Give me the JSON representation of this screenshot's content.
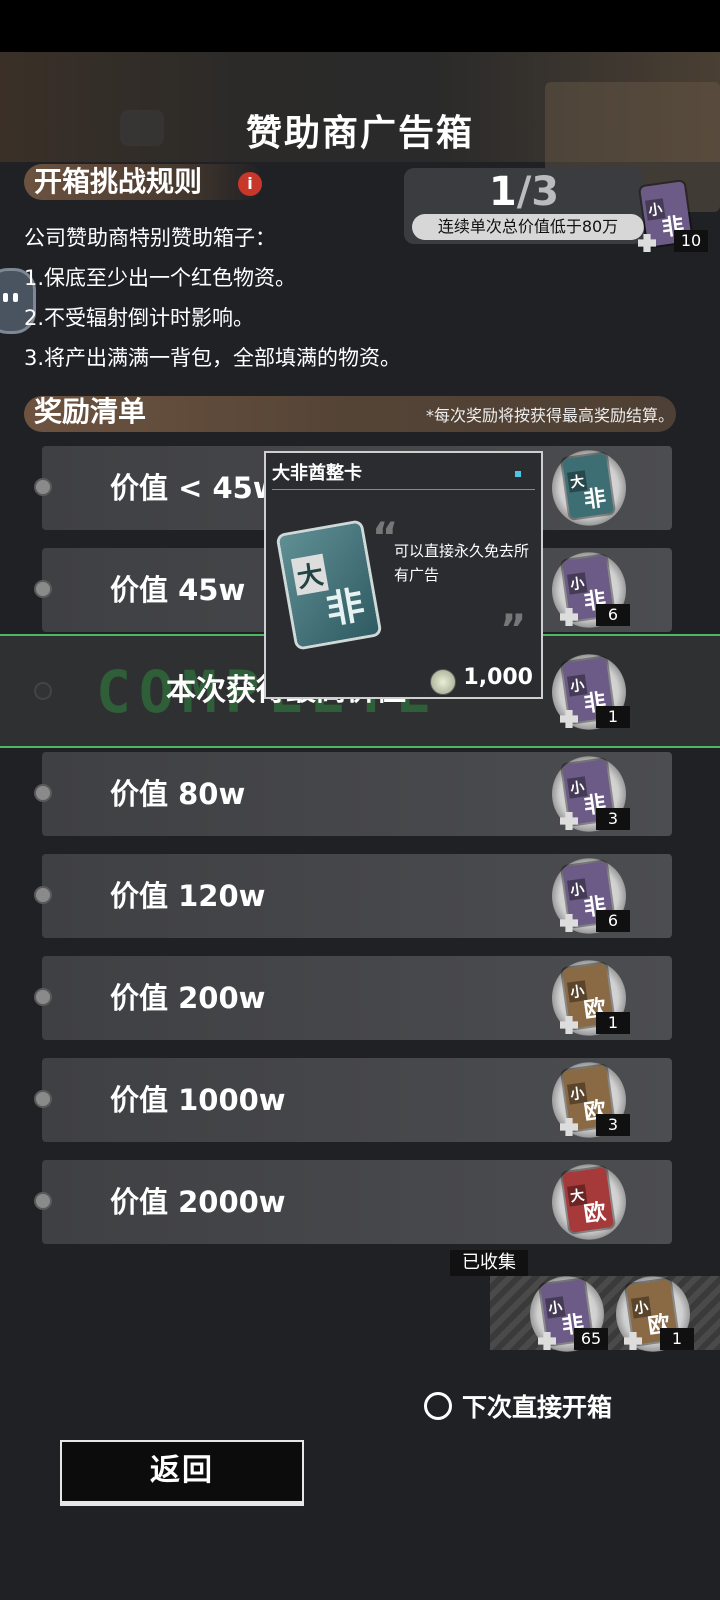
{
  "header": {
    "title": "赞助商广告箱"
  },
  "rules": {
    "title": "开箱挑战规则",
    "info_icon": "info-icon",
    "lines": [
      "公司赞助商特别赞助箱子：",
      "1.保底至少出一个红色物资。",
      "2.不受辐射倒计时影响。",
      "3.将产出满满一背包，全部填满的物资。"
    ]
  },
  "progress": {
    "current": "1",
    "total": "/3",
    "note": "连续单次总价值低于80万",
    "card": {
      "top": "小",
      "bottom": "非",
      "color": "#6c5b86",
      "count": "10"
    }
  },
  "rewards": {
    "title": "奖励清单",
    "note": "*每次奖励将按获得最高奖励结算。",
    "rows": [
      {
        "label": "价值 < 45w",
        "card": {
          "top": "大",
          "bottom": "非",
          "color": "#3d6e74",
          "count": ""
        }
      },
      {
        "label": "价值 45w",
        "card": {
          "top": "小",
          "bottom": "非",
          "color": "#6c5b86",
          "count": "6"
        }
      },
      {
        "label": "本次获得最高价值",
        "ghost": "COMPLETE",
        "card": {
          "top": "小",
          "bottom": "非",
          "color": "#6c5b86",
          "count": "1"
        }
      },
      {
        "label": "价值 80w",
        "card": {
          "top": "小",
          "bottom": "非",
          "color": "#6c5b86",
          "count": "3"
        }
      },
      {
        "label": "价值 120w",
        "card": {
          "top": "小",
          "bottom": "非",
          "color": "#6c5b86",
          "count": "6"
        }
      },
      {
        "label": "价值 200w",
        "card": {
          "top": "小",
          "bottom": "欧",
          "color": "#8a6a44",
          "count": "1"
        }
      },
      {
        "label": "价值 1000w",
        "card": {
          "top": "小",
          "bottom": "欧",
          "color": "#8a6a44",
          "count": "3"
        }
      },
      {
        "label": "价值 2000w",
        "card": {
          "top": "大",
          "bottom": "欧",
          "color": "#a6393a",
          "count": ""
        }
      }
    ]
  },
  "popup": {
    "title": "大非酋整卡",
    "card_top": "大",
    "card_bottom": "非",
    "description": "可以直接永久免去所有广告",
    "price": "1,000"
  },
  "collected": {
    "label": "已收集",
    "items": [
      {
        "top": "小",
        "bottom": "非",
        "color": "#6c5b86",
        "count": "65"
      },
      {
        "top": "小",
        "bottom": "欧",
        "color": "#8a6a44",
        "count": "1"
      }
    ]
  },
  "options": {
    "direct_open_label": "下次直接开箱"
  },
  "footer": {
    "back_label": "返回"
  }
}
